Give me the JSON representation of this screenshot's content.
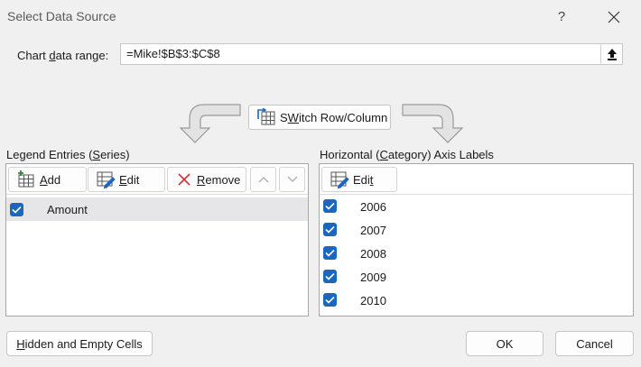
{
  "window": {
    "title": "Select Data Source",
    "help_glyph": "?",
    "close_icon": "close-icon"
  },
  "range": {
    "label_pre": "Chart ",
    "label_u": "d",
    "label_post": "ata range:",
    "value": "=Mike!$B$3:$C$8"
  },
  "switch_button": {
    "label_u": "W",
    "label_pre": "S",
    "label_post": "itch Row/Column"
  },
  "legend": {
    "label_pre": "Legend Entries (",
    "label_u": "S",
    "label_post": "eries)",
    "add_u": "A",
    "add_post": "dd",
    "edit_u": "E",
    "edit_post": "dit",
    "remove_u": "R",
    "remove_post": "emove",
    "up_glyph": "⌃",
    "down_glyph": "⌄",
    "series": [
      {
        "name": "Amount",
        "checked": true
      }
    ]
  },
  "axis": {
    "label_pre": "Horizontal (",
    "label_u": "C",
    "label_post": "ategory) Axis Labels",
    "edit_pre": "Edi",
    "edit_u": "t",
    "categories": [
      {
        "name": "2006",
        "checked": true
      },
      {
        "name": "2007",
        "checked": true
      },
      {
        "name": "2008",
        "checked": true
      },
      {
        "name": "2009",
        "checked": true
      },
      {
        "name": "2010",
        "checked": true
      }
    ]
  },
  "footer": {
    "hidden_u": "H",
    "hidden_post": "idden and Empty Cells",
    "ok": "OK",
    "cancel": "Cancel"
  },
  "colors": {
    "accent": "#1c67be",
    "remove_red": "#d13438",
    "selected_row": "#e6e6e9"
  }
}
